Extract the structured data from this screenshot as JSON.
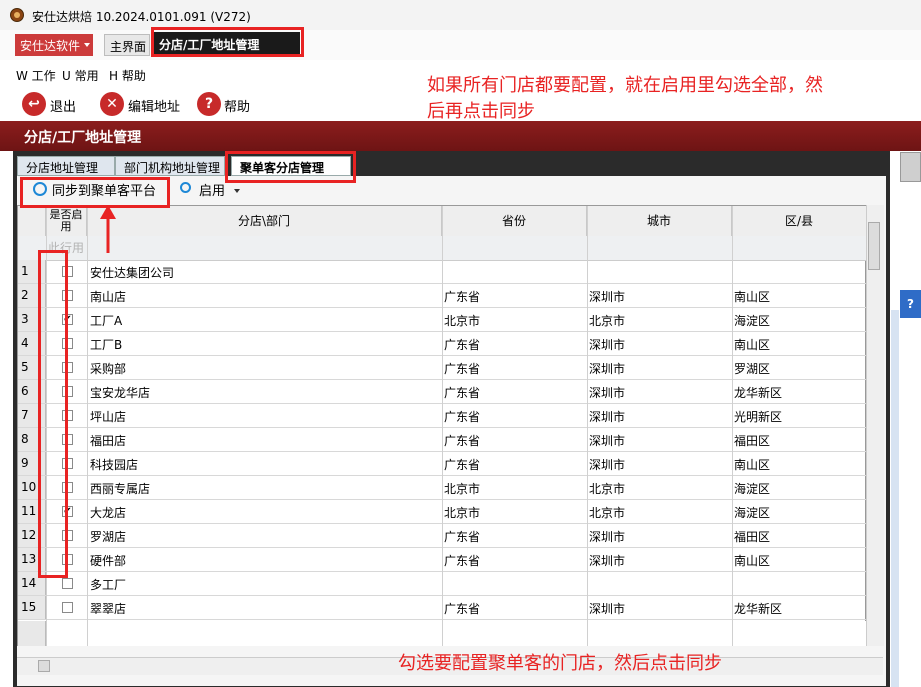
{
  "window": {
    "title": "安仕达烘焙   10.2024.0101.091 (V272)"
  },
  "toptabs": {
    "brand_menu": "安仕达软件",
    "main_tab": "主界面",
    "active_tab": "分店/工厂地址管理"
  },
  "menu": [
    {
      "label": "W 工作"
    },
    {
      "label": "U 常用"
    },
    {
      "label": "H 帮助"
    }
  ],
  "toolbar": {
    "exit": "退出",
    "edit": "编辑地址",
    "help": "帮助"
  },
  "header": {
    "title": "分店/工厂地址管理"
  },
  "subtabs": [
    {
      "label": "分店地址管理"
    },
    {
      "label": "部门机构地址管理"
    },
    {
      "label": "聚单客分店管理"
    }
  ],
  "panel": {
    "sync_label": "同步到聚单客平台",
    "enable_label": "启用"
  },
  "grid": {
    "columns": [
      "是否启用",
      "分店\\部门",
      "省份",
      "城市",
      "区/县"
    ],
    "filter_placeholder": "此行用",
    "rows": [
      {
        "n": "1",
        "checked": false,
        "name": "安仕达集团公司",
        "province": "",
        "city": "",
        "district": ""
      },
      {
        "n": "2",
        "checked": false,
        "name": "南山店",
        "province": "广东省",
        "city": "深圳市",
        "district": "南山区"
      },
      {
        "n": "3",
        "checked": true,
        "name": "工厂A",
        "province": "北京市",
        "city": "北京市",
        "district": "海淀区"
      },
      {
        "n": "4",
        "checked": false,
        "name": "工厂B",
        "province": "广东省",
        "city": "深圳市",
        "district": "南山区"
      },
      {
        "n": "5",
        "checked": false,
        "name": "采购部",
        "province": "广东省",
        "city": "深圳市",
        "district": "罗湖区"
      },
      {
        "n": "6",
        "checked": false,
        "name": "宝安龙华店",
        "province": "广东省",
        "city": "深圳市",
        "district": "龙华新区"
      },
      {
        "n": "7",
        "checked": false,
        "name": "坪山店",
        "province": "广东省",
        "city": "深圳市",
        "district": "光明新区"
      },
      {
        "n": "8",
        "checked": false,
        "name": "福田店",
        "province": "广东省",
        "city": "深圳市",
        "district": "福田区"
      },
      {
        "n": "9",
        "checked": false,
        "name": "科技园店",
        "province": "广东省",
        "city": "深圳市",
        "district": "南山区"
      },
      {
        "n": "10",
        "checked": false,
        "name": "西丽专属店",
        "province": "北京市",
        "city": "北京市",
        "district": "海淀区"
      },
      {
        "n": "11",
        "checked": true,
        "name": "大龙店",
        "province": "北京市",
        "city": "北京市",
        "district": "海淀区"
      },
      {
        "n": "12",
        "checked": false,
        "name": "罗湖店",
        "province": "广东省",
        "city": "深圳市",
        "district": "福田区"
      },
      {
        "n": "13",
        "checked": false,
        "name": "硬件部",
        "province": "广东省",
        "city": "深圳市",
        "district": "南山区"
      },
      {
        "n": "14",
        "checked": false,
        "name": "多工厂",
        "province": "",
        "city": "",
        "district": ""
      },
      {
        "n": "15",
        "checked": false,
        "name": "翠翠店",
        "province": "广东省",
        "city": "深圳市",
        "district": "龙华新区"
      }
    ]
  },
  "annotations": {
    "top_line1": "如果所有门店都要配置，就在启用里勾选全部，然",
    "top_line2": "后再点击同步",
    "bottom": "勾选要配置聚单客的门店，然后点击同步"
  },
  "colors": {
    "annotation_red": "#e82323",
    "header_red": "#8c1d1d",
    "brand_red": "#cc3b3b"
  }
}
